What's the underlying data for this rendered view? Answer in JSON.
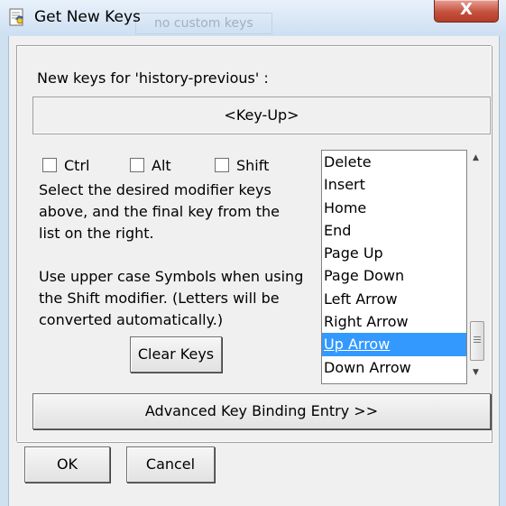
{
  "window": {
    "title": "Get New Keys",
    "close_glyph": "X",
    "background_faint_text": "no custom keys"
  },
  "dialog": {
    "new_keys_label": "New keys for  'history-previous' :",
    "key_display": "<Key-Up>",
    "modifiers": [
      {
        "label": "Ctrl",
        "checked": false
      },
      {
        "label": "Alt",
        "checked": false
      },
      {
        "label": "Shift",
        "checked": false
      }
    ],
    "instructions_1": [
      "Select the desired modifier keys",
      "above, and the final key from the",
      "list on the right."
    ],
    "instructions_2": [
      "Use upper case Symbols when using",
      "the Shift modifier.  (Letters will be",
      "converted automatically.)"
    ],
    "clear_keys_label": "Clear Keys",
    "key_list": [
      "Delete",
      "Insert",
      "Home",
      "End",
      "Page Up",
      "Page Down",
      "Left Arrow",
      "Right Arrow",
      "Up Arrow",
      "Down Arrow"
    ],
    "selected_key": "Up Arrow",
    "advanced_label": "Advanced Key Binding Entry >>",
    "ok_label": "OK",
    "cancel_label": "Cancel"
  },
  "colors": {
    "selection": "#3399ff",
    "close_button": "#c4523e"
  }
}
